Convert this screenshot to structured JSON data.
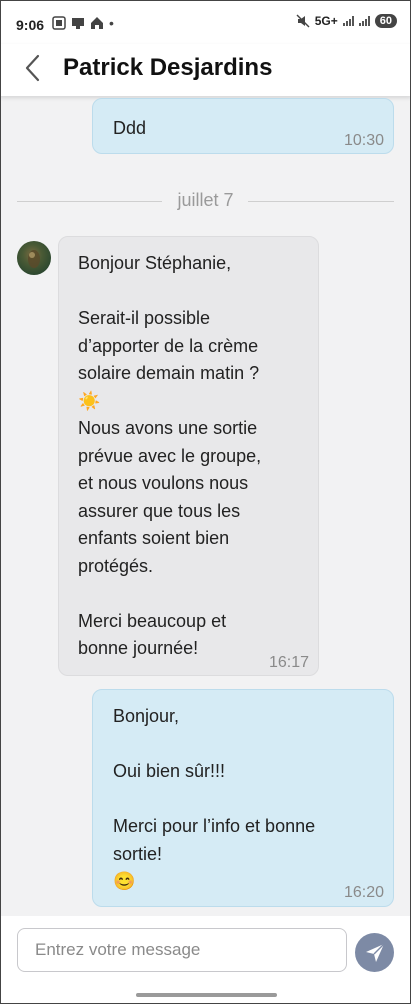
{
  "status": {
    "time": "9:06",
    "network": "5G+",
    "battery": "60"
  },
  "header": {
    "title": "Patrick Desjardins"
  },
  "messages": [
    {
      "direction": "out",
      "text": "Ddd",
      "time": "10:30"
    },
    {
      "direction": "in",
      "text": "Bonjour Stéphanie,\n\nSerait-il possible\nd’apporter de la crème\nsolaire demain matin ?\n☀️\nNous avons une sortie\nprévue avec le groupe,\net nous voulons nous\nassurer que tous les\nenfants soient bien\nprotégés.\n\nMerci beaucoup et\nbonne journée!",
      "time": "16:17"
    },
    {
      "direction": "out",
      "text": "Bonjour,\n\nOui bien sûr!!!\n\nMerci pour l’info et bonne\nsortie!\n😊",
      "time": "16:20"
    }
  ],
  "date_separator": "juillet 7",
  "composer": {
    "placeholder": "Entrez votre message"
  },
  "colors": {
    "outgoing_bubble": "#d5ebf5",
    "incoming_bubble": "#e8e8ea",
    "send_button": "#7d8aa5"
  }
}
